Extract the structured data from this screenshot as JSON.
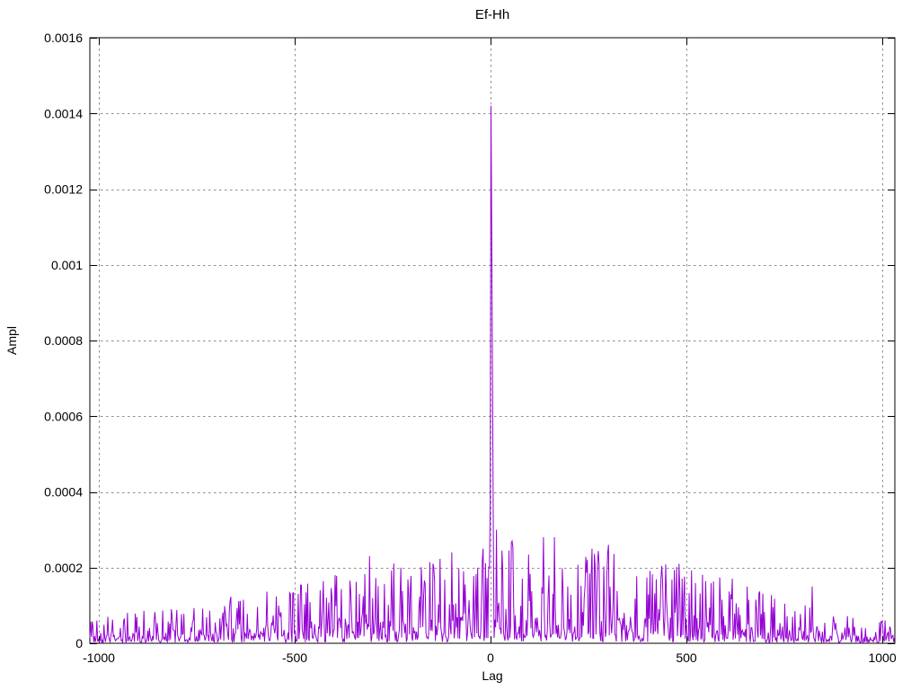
{
  "chart_data": {
    "type": "line",
    "title": "Ef-Hh",
    "xlabel": "Lag",
    "ylabel": "Ampl",
    "legend": "none",
    "grid": true,
    "xlim": [
      -1023,
      1032
    ],
    "ylim": [
      0,
      0.0016
    ],
    "x_ticks": [
      -1000,
      -500,
      0,
      500,
      1000
    ],
    "x_tick_labels": [
      "-1000",
      "-500",
      "0",
      "500",
      "1000"
    ],
    "y_ticks": [
      0,
      0.0002,
      0.0004,
      0.0006,
      0.0008,
      0.001,
      0.0012,
      0.0014,
      0.0016
    ],
    "y_tick_labels": [
      "0",
      "0.0002",
      "0.0004",
      "0.0006",
      "0.0008",
      "0.001",
      "0.0012",
      "0.0014",
      "0.0016"
    ],
    "colors": {
      "line": "#9400d3",
      "grid": "#8c8c8c",
      "border": "#000000",
      "text": "#000000",
      "background": "#ffffff"
    },
    "main_peak": {
      "lag": 0,
      "ampl": 0.00142
    },
    "peak_shoulders": [
      [
        -4,
        0.0002
      ],
      [
        -2,
        0.00035
      ],
      [
        2,
        0.00108
      ],
      [
        4,
        0.00068
      ],
      [
        6,
        0.0003
      ]
    ],
    "notable_peaks": [
      [
        -310,
        0.00023
      ],
      [
        -100,
        0.00024
      ],
      [
        -20,
        0.00025
      ],
      [
        15,
        0.0003
      ],
      [
        55,
        0.00027
      ],
      [
        135,
        0.00028
      ],
      [
        163,
        0.00028
      ],
      [
        300,
        0.00026
      ],
      [
        480,
        0.00021
      ],
      [
        820,
        0.00015
      ]
    ],
    "noise_envelope": [
      [
        -1023,
        6e-05
      ],
      [
        -950,
        8e-05
      ],
      [
        -900,
        0.0001
      ],
      [
        -850,
        9e-05
      ],
      [
        -800,
        0.0001
      ],
      [
        -750,
        0.00011
      ],
      [
        -700,
        0.00011
      ],
      [
        -650,
        0.00013
      ],
      [
        -600,
        0.00014
      ],
      [
        -550,
        0.00015
      ],
      [
        -500,
        0.00015
      ],
      [
        -450,
        0.00017
      ],
      [
        -400,
        0.00018
      ],
      [
        -350,
        0.00019
      ],
      [
        -300,
        0.00021
      ],
      [
        -250,
        0.00022
      ],
      [
        -200,
        0.00021
      ],
      [
        -150,
        0.00022
      ],
      [
        -100,
        0.00024
      ],
      [
        -50,
        0.00023
      ],
      [
        0,
        0.00028
      ],
      [
        50,
        0.00027
      ],
      [
        100,
        0.00026
      ],
      [
        150,
        0.00028
      ],
      [
        200,
        0.00024
      ],
      [
        250,
        0.00026
      ],
      [
        300,
        0.00025
      ],
      [
        350,
        0.00021
      ],
      [
        400,
        0.0002
      ],
      [
        450,
        0.00021
      ],
      [
        500,
        0.0002
      ],
      [
        550,
        0.0002
      ],
      [
        600,
        0.00018
      ],
      [
        650,
        0.00016
      ],
      [
        700,
        0.00014
      ],
      [
        750,
        0.00012
      ],
      [
        800,
        0.00012
      ],
      [
        850,
        0.0001
      ],
      [
        900,
        8e-05
      ],
      [
        950,
        6e-05
      ],
      [
        1000,
        6e-05
      ],
      [
        1032,
        7e-05
      ]
    ],
    "noise_seed": 20240817,
    "noise_step_lags": 2
  }
}
